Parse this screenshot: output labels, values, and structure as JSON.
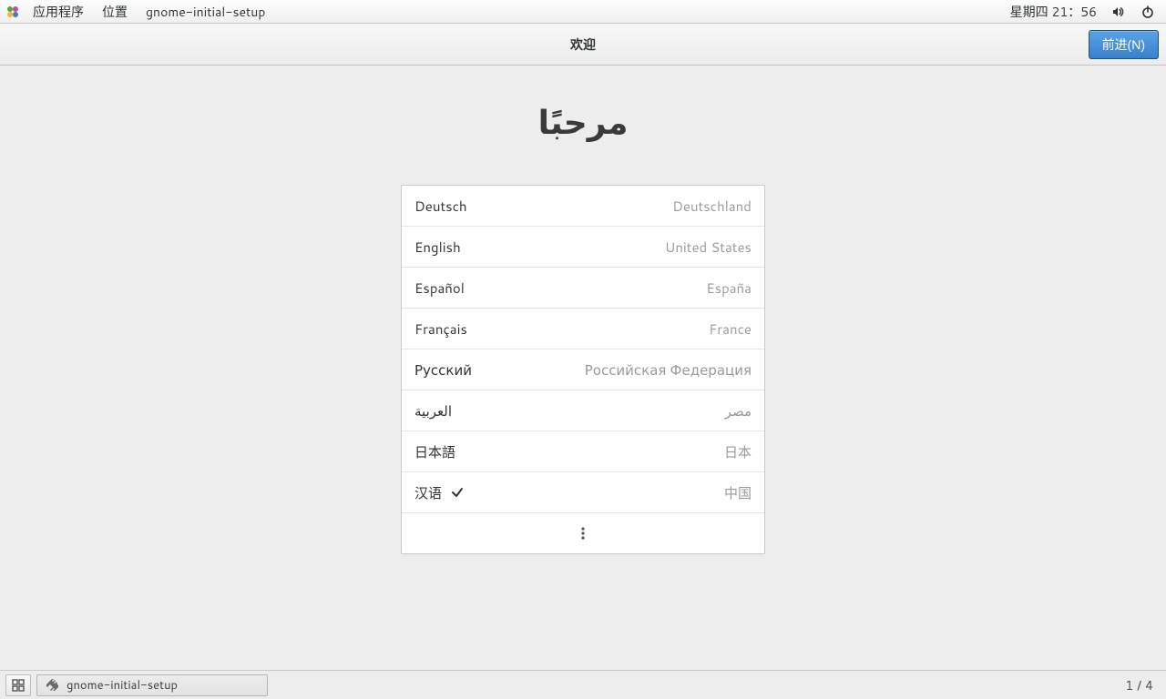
{
  "top_panel": {
    "applications": "应用程序",
    "places": "位置",
    "app_title": "gnome-initial-setup",
    "clock": "星期四 21：56"
  },
  "header": {
    "title": "欢迎",
    "next": "前进(N)"
  },
  "welcome_word": "مرحبًا",
  "languages": [
    {
      "name": "Deutsch",
      "region": "Deutschland",
      "selected": false
    },
    {
      "name": "English",
      "region": "United States",
      "selected": false
    },
    {
      "name": "Español",
      "region": "España",
      "selected": false
    },
    {
      "name": "Français",
      "region": "France",
      "selected": false
    },
    {
      "name": "Русский",
      "region": "Российская Федерация",
      "selected": false
    },
    {
      "name": "العربية",
      "region": "مصر",
      "selected": false
    },
    {
      "name": "日本語",
      "region": "日本",
      "selected": false
    },
    {
      "name": "汉语",
      "region": "中国",
      "selected": true
    }
  ],
  "taskbar": {
    "task_label": "gnome-initial-setup",
    "workspace_current": "1",
    "workspace_sep": "/",
    "workspace_total": "4"
  }
}
